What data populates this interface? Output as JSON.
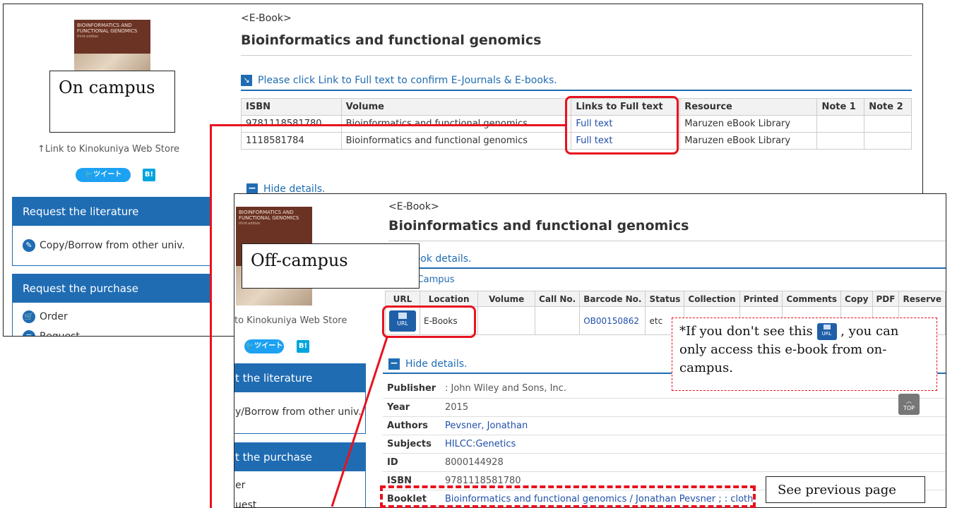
{
  "on_campus": {
    "callout": "On campus",
    "cover_title": "BIOINFORMATICS AND FUNCTIONAL GENOMICS",
    "cover_sub": "third edition",
    "kinokuniya_link": "↑Link to Kinokuniya Web Store",
    "tweet_label": "ツイート",
    "hatena_label": "B!",
    "request_literature": {
      "title": "Request the literature",
      "items": [
        "Copy/Borrow from other univ."
      ]
    },
    "request_purchase": {
      "title": "Request the purchase",
      "items": [
        "Order",
        "Request"
      ]
    },
    "ebook_tag": "<E-Book>",
    "title": "Bioinformatics and functional genomics",
    "notice": "Please click Link to Full text to confirm E-Journals & E-books.",
    "table": {
      "headers": [
        "ISBN",
        "Volume",
        "Links to Full text",
        "Resource",
        "Note 1",
        "Note 2"
      ],
      "rows": [
        [
          "9781118581780",
          "Bioinformatics and functional genomics",
          "Full text",
          "Maruzen eBook Library",
          "",
          ""
        ],
        [
          "1118581784",
          "Bioinformatics and functional genomics",
          "Full text",
          "Maruzen eBook Library",
          "",
          ""
        ]
      ]
    },
    "hide_details": "Hide details."
  },
  "off_campus": {
    "callout": "Off-campus",
    "ebook_tag": "<E-Book>",
    "title": "Bioinformatics and functional genomics",
    "hide_book_details": "ide book details.",
    "campus": "ongo Campus",
    "holdings": {
      "headers": [
        "URL",
        "Location",
        "Volume",
        "Call No.",
        "Barcode No.",
        "Status",
        "Collection",
        "Printed",
        "Comments",
        "Copy",
        "PDF",
        "Reserve"
      ],
      "url_label": "URL",
      "location": "E-Books",
      "barcode": "OB00150862",
      "status": "etc"
    },
    "sidebar": {
      "kinokuniya_link": "to Kinokuniya Web Store",
      "tweet_label": "ツイート",
      "hatena_label": "B!",
      "literature_head": "t the literature",
      "literature_item": "y/Borrow from other univ.",
      "purchase_head": "t the purchase",
      "items": [
        "er",
        "uest"
      ]
    },
    "hide_details": "Hide details.",
    "details": [
      {
        "label": "Publisher",
        "value": ": John Wiley and Sons, Inc.",
        "link": false
      },
      {
        "label": "Year",
        "value": "2015",
        "link": false
      },
      {
        "label": "Authors",
        "value": "Pevsner, Jonathan",
        "link": true
      },
      {
        "label": "Subjects",
        "value": "HILCC:Genetics",
        "link": true
      },
      {
        "label": "ID",
        "value": "8000144928",
        "link": false
      },
      {
        "label": "ISBN",
        "value": "9781118581780",
        "link": false
      },
      {
        "label": "Booklet",
        "value": "Bioinformatics and functional genomics / Jonathan Pevsner ; : cloth",
        "link": true
      }
    ],
    "note": {
      "before": "*If you don't see this",
      "after": ", you can only access this e-book from on-campus."
    },
    "top_label": "TOP",
    "see_previous": "See previous page"
  }
}
